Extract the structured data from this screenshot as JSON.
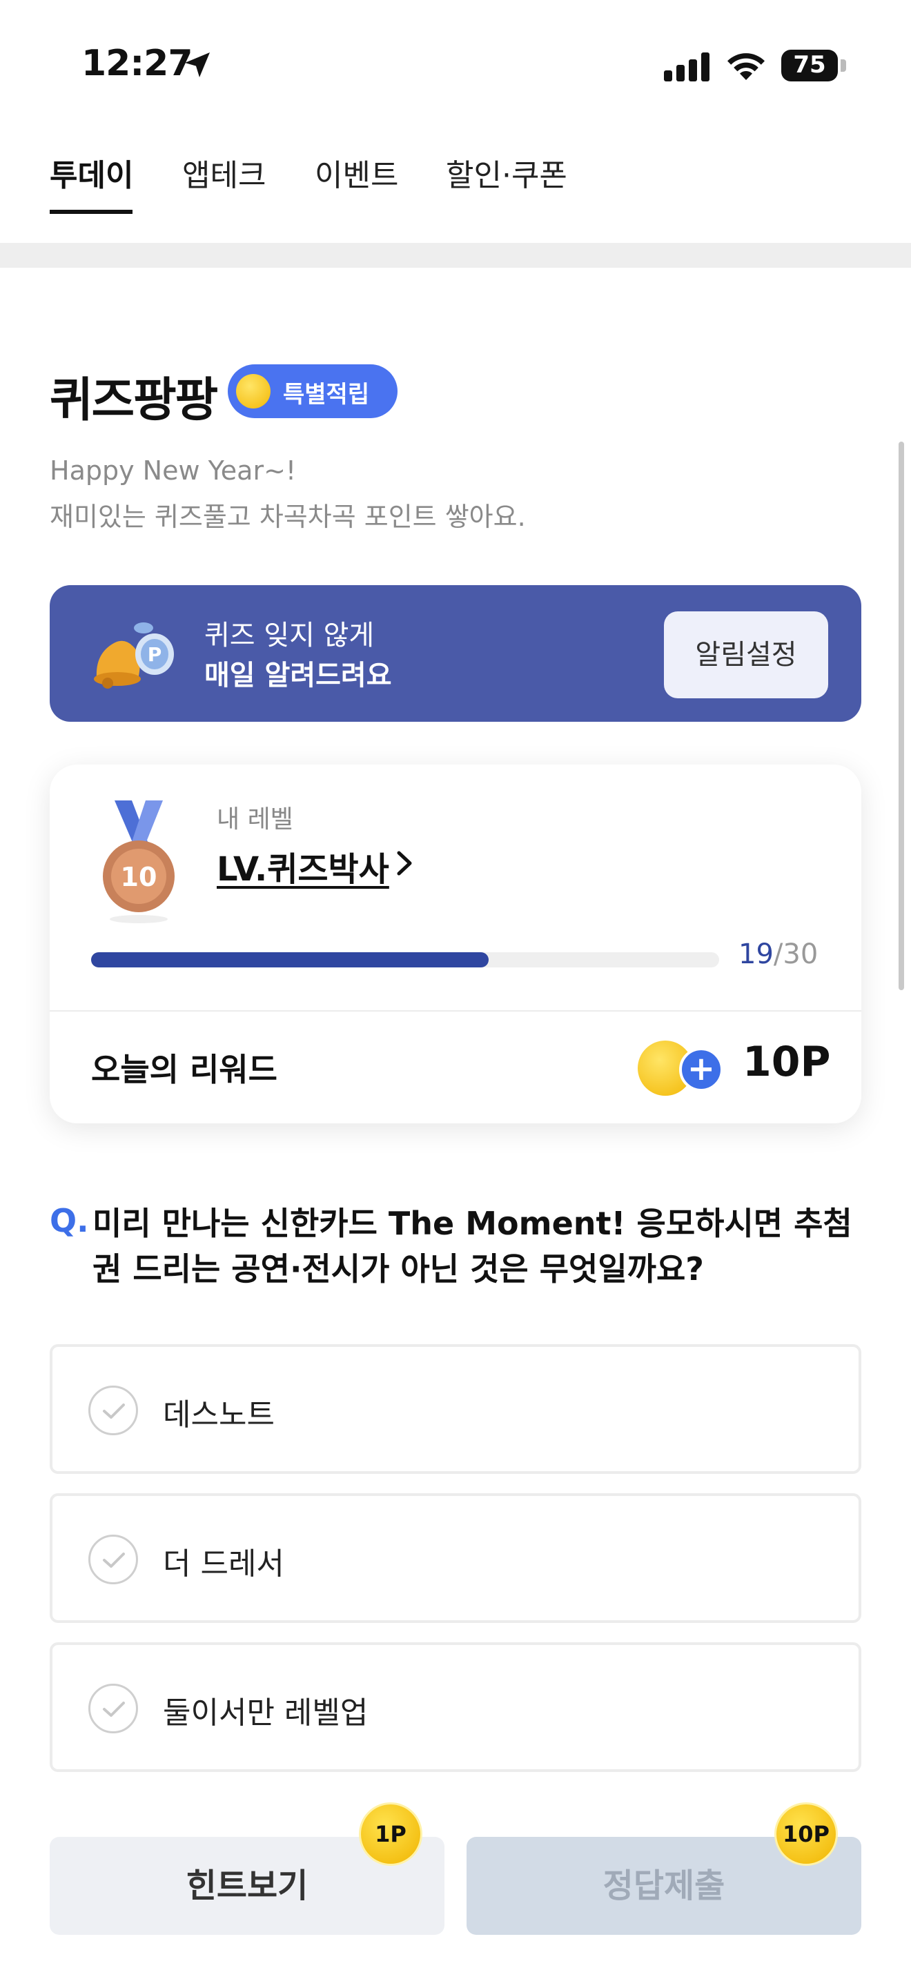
{
  "status_bar": {
    "time": "12:27",
    "battery": "75"
  },
  "tabs": [
    {
      "label": "투데이"
    },
    {
      "label": "앱테크"
    },
    {
      "label": "이벤트"
    },
    {
      "label": "할인·쿠폰"
    }
  ],
  "header": {
    "title": "퀴즈팡팡",
    "badge": "특별적립",
    "subtitle_line1": "Happy New Year~!",
    "subtitle_line2": "재미있는 퀴즈풀고 차곡차곡 포인트 쌓아요."
  },
  "banner": {
    "line1": "퀴즈 잊지 않게",
    "line2": "매일 알려드려요",
    "button": "알림설정"
  },
  "level_card": {
    "my_level_label": "내 레벨",
    "level_name": "LV.퀴즈박사",
    "medal_number": "10",
    "progress_current": "19",
    "progress_total": "/30",
    "progress_fraction": 0.633,
    "reward_label": "오늘의 리워드",
    "reward_value": "10P"
  },
  "question": {
    "prefix": "Q.",
    "text": "미리 만나는 신한카드 The Moment! 응모하시면 추첨권 드리는 공연·전시가 아닌 것은 무엇일까요?",
    "options": [
      {
        "label": "데스노트"
      },
      {
        "label": "더 드레서"
      },
      {
        "label": "둘이서만 레벨업"
      }
    ]
  },
  "actions": {
    "hint_label": "힌트보기",
    "hint_cost": "1P",
    "submit_label": "정답제출",
    "submit_cost": "10P"
  },
  "colors": {
    "accent_blue": "#3d6fe8",
    "banner_bg": "#4a5aa8",
    "progress_fill": "#2f46a0",
    "coin_gold": "#f2b705"
  }
}
